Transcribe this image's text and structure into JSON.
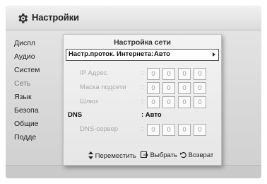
{
  "header": {
    "title": "Настройки",
    "icon": "gear-icon"
  },
  "menu": {
    "items": [
      {
        "label": "Диспл"
      },
      {
        "label": "Аудио"
      },
      {
        "label": "Систем"
      },
      {
        "label": "Сеть",
        "selected": true
      },
      {
        "label": "Язык"
      },
      {
        "label": "Безопа"
      },
      {
        "label": "Общие"
      },
      {
        "label": "Подде"
      }
    ]
  },
  "dialog": {
    "title": "Настройка сети",
    "protocol": {
      "label": "Настр.проток. Интернета:",
      "value": "Авто"
    },
    "ip": {
      "label": "IP Адрес",
      "octets": [
        "0",
        "0",
        "0",
        "0"
      ]
    },
    "mask": {
      "label": "Маска подсети",
      "octets": [
        "0",
        "0",
        "0",
        "0"
      ]
    },
    "gateway": {
      "label": "Шлюз",
      "octets": [
        "0",
        "0",
        "0",
        "0"
      ]
    },
    "dns": {
      "label": "DNS",
      "value": ": Авто"
    },
    "dns_server": {
      "label": "DNS-сервер",
      "octets": [
        "0",
        "0",
        "0",
        "0"
      ]
    },
    "footer": {
      "move": "Переместить",
      "select": "Выбрать",
      "back": "Возврат"
    }
  },
  "colors": {
    "background": "#d9d9d9",
    "dialog": "#ececec",
    "disabled_text": "#a8a8a8",
    "highlight": "#ffffff"
  }
}
